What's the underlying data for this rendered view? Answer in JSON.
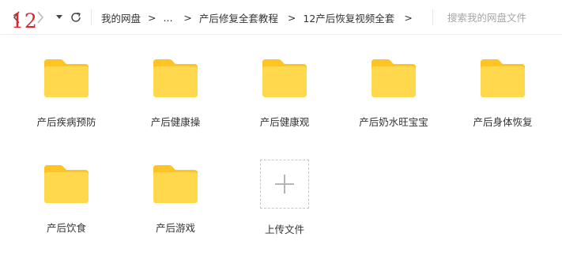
{
  "overlay_number": "12",
  "nav": {
    "back_icon": "chevron-left-icon",
    "forward_icon": "chevron-right-icon",
    "dropdown_icon": "caret-down-icon",
    "refresh_icon": "refresh-icon"
  },
  "breadcrumb": {
    "separator": ">",
    "items": [
      "我的网盘",
      "...",
      "产后修复全套教程",
      "12产后恢复视频全套"
    ]
  },
  "search": {
    "placeholder": "搜索我的网盘文件",
    "value": ""
  },
  "folder_color": "#ffd84d",
  "folder_tab_color": "#ffc423",
  "items": [
    {
      "label": "产后疾病预防",
      "icon": "folder-icon"
    },
    {
      "label": "产后健康操",
      "icon": "folder-icon"
    },
    {
      "label": "产后健康观",
      "icon": "folder-icon"
    },
    {
      "label": "产后奶水旺宝宝",
      "icon": "folder-icon"
    },
    {
      "label": "产后身体恢复",
      "icon": "folder-icon"
    },
    {
      "label": "产后饮食",
      "icon": "folder-icon"
    },
    {
      "label": "产后游戏",
      "icon": "folder-icon"
    }
  ],
  "upload": {
    "label": "上传文件",
    "icon": "plus-icon"
  }
}
